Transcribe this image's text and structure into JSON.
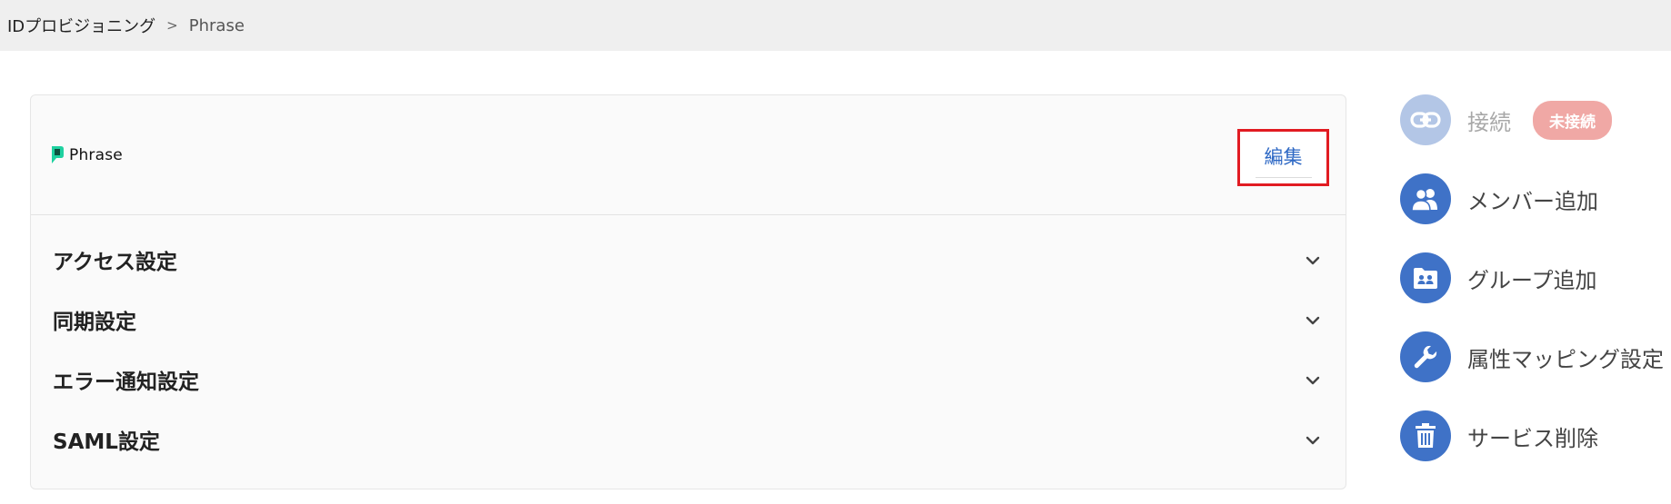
{
  "breadcrumb": {
    "parent": "IDプロビジョニング",
    "separator": ">",
    "current": "Phrase"
  },
  "card": {
    "logo_text": "Phrase",
    "edit_label": "編集",
    "sections": [
      {
        "label": "アクセス設定"
      },
      {
        "label": "同期設定"
      },
      {
        "label": "エラー通知設定"
      },
      {
        "label": "SAML設定"
      }
    ]
  },
  "actions": {
    "connect": {
      "label": "接続",
      "badge": "未接続",
      "icon": "link-icon"
    },
    "add_member": {
      "label": "メンバー追加",
      "icon": "users-icon"
    },
    "add_group": {
      "label": "グループ追加",
      "icon": "group-folder-icon"
    },
    "attribute_mapping": {
      "label": "属性マッピング設定",
      "icon": "wrench-icon"
    },
    "delete_service": {
      "label": "サービス削除",
      "icon": "trash-icon"
    }
  },
  "colors": {
    "accent": "#3f72c7",
    "accent_disabled": "#b3c6e6",
    "highlight_border": "#e11b22",
    "badge": "#f0a8a5",
    "logo": "#1fd1a0"
  }
}
